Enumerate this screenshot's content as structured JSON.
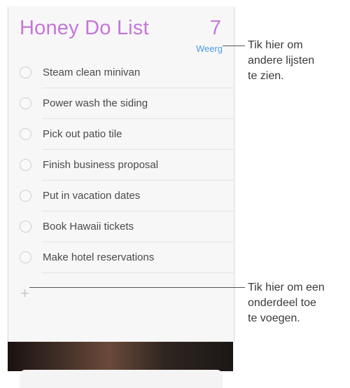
{
  "list": {
    "title": "Honey Do List",
    "count": "7",
    "back_label": "Weerg",
    "accent_color": "#c576d9",
    "link_color": "#4d9be6",
    "items": [
      {
        "label": "Steam clean minivan",
        "checked": false
      },
      {
        "label": "Power wash the siding",
        "checked": false
      },
      {
        "label": "Pick out patio tile",
        "checked": false
      },
      {
        "label": "Finish business proposal",
        "checked": false
      },
      {
        "label": "Put in vacation dates",
        "checked": false
      },
      {
        "label": "Book Hawaii tickets",
        "checked": false
      },
      {
        "label": "Make hotel reservations",
        "checked": false
      }
    ],
    "add_icon": "plus-icon",
    "add_glyph": "+"
  },
  "callouts": {
    "lists": [
      "Tik hier om",
      "andere lijsten",
      "te zien."
    ],
    "add_item": [
      "Tik hier om een",
      "onderdeel toe",
      "te voegen."
    ]
  }
}
